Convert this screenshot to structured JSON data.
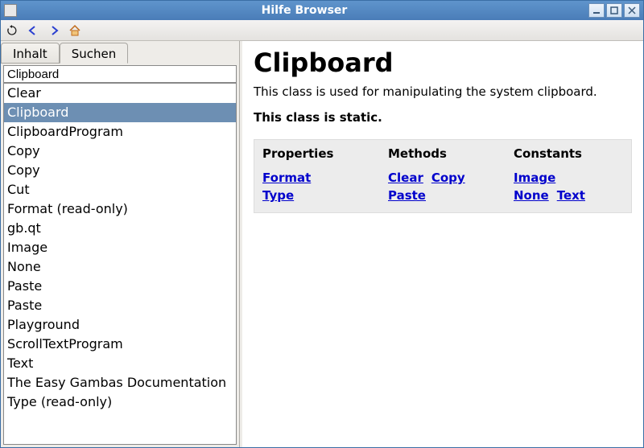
{
  "window": {
    "title": "Hilfe Browser"
  },
  "tabs": {
    "inhalt": "Inhalt",
    "suchen": "Suchen"
  },
  "search": {
    "value": "Clipboard"
  },
  "results": [
    "Clear",
    "Clipboard",
    "ClipboardProgram",
    "Copy",
    "Copy",
    "Cut",
    "Format (read-only)",
    "gb.qt",
    "Image",
    "None",
    "Paste",
    "Paste",
    "Playground",
    "ScrollTextProgram",
    "Text",
    "The Easy Gambas Documentation",
    "Type (read-only)"
  ],
  "results_selected_index": 1,
  "doc": {
    "title": "Clipboard",
    "description": "This class is used for manipulating the system clipboard.",
    "static_note": "This class is static.",
    "headers": {
      "properties": "Properties",
      "methods": "Methods",
      "constants": "Constants"
    },
    "properties": [
      "Format",
      "Type"
    ],
    "methods": [
      "Clear",
      "Copy",
      "Paste"
    ],
    "constants": [
      "Image",
      "None",
      "Text"
    ]
  }
}
